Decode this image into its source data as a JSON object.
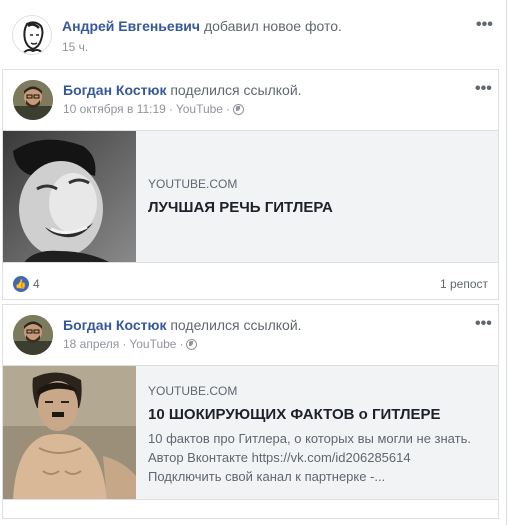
{
  "top_post": {
    "author": "Андрей Евгеньевич",
    "action": "добавил новое фото.",
    "time": "15 ч.",
    "menu": "•••"
  },
  "posts": [
    {
      "author": "Богдан Костюк",
      "action": "поделился ссылкой.",
      "date": "10 октября в 11:19",
      "separator": "·",
      "source": "YouTube",
      "separator2": "·",
      "menu": "•••",
      "link": {
        "domain": "YOUTUBE.COM",
        "title": "ЛУЧШАЯ РЕЧЬ ГИТЛЕРА"
      },
      "likes": "4",
      "reposts": "1 репост"
    },
    {
      "author": "Богдан Костюк",
      "action": "поделился ссылкой.",
      "date": "18 апреля",
      "separator": "·",
      "source": "YouTube",
      "separator2": "·",
      "menu": "•••",
      "link": {
        "domain": "YOUTUBE.COM",
        "title": "10 ШОКИРУЮЩИХ ФАКТОВ о ГИТЛЕРЕ",
        "desc_lines": [
          "10 фактов про Гитлера, о которых вы могли не знать.",
          "Автор Вконтакте https://vk.com/id206285614",
          "Подключить свой канал к партнерке -..."
        ]
      }
    }
  ],
  "colors": {
    "link_name": "#365899",
    "like_blue": "#4267b2",
    "background": "#e9ebee"
  }
}
